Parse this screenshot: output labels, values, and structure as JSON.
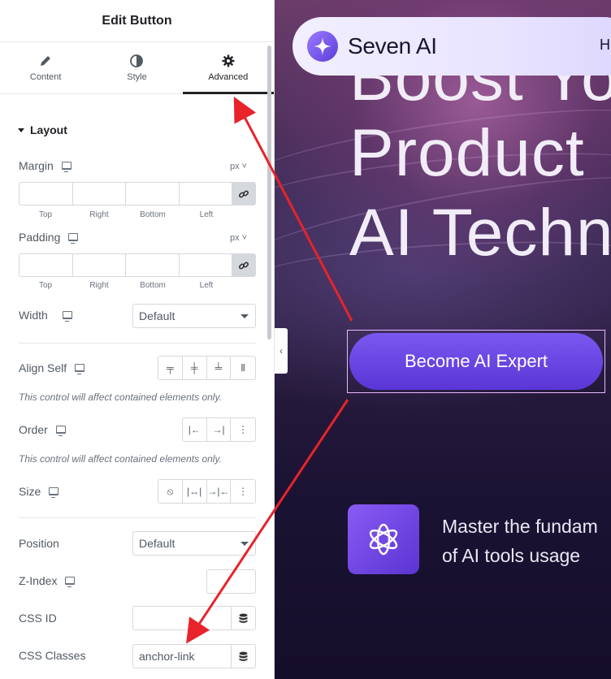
{
  "panel": {
    "title": "Edit Button",
    "tabs": [
      {
        "label": "Content",
        "icon": "pencil-icon"
      },
      {
        "label": "Style",
        "icon": "half-circle-icon"
      },
      {
        "label": "Advanced",
        "icon": "gear-icon",
        "active": true
      }
    ],
    "section": "Layout",
    "margin": {
      "label": "Margin",
      "unit": "px",
      "sides": [
        "Top",
        "Right",
        "Bottom",
        "Left"
      ]
    },
    "padding": {
      "label": "Padding",
      "unit": "px",
      "sides": [
        "Top",
        "Right",
        "Bottom",
        "Left"
      ]
    },
    "width": {
      "label": "Width",
      "value": "Default"
    },
    "align_self": {
      "label": "Align Self",
      "note": "This control will affect contained elements only."
    },
    "order": {
      "label": "Order",
      "note": "This control will affect contained elements only."
    },
    "size": {
      "label": "Size"
    },
    "position": {
      "label": "Position",
      "value": "Default"
    },
    "z_index": {
      "label": "Z-Index",
      "value": ""
    },
    "css_id": {
      "label": "CSS ID",
      "value": ""
    },
    "css_classes": {
      "label": "CSS Classes",
      "value": "anchor-link"
    }
  },
  "preview": {
    "brand": "Seven AI",
    "nav_link": "H",
    "hero_lines": [
      "Boost Yo",
      "Product",
      "AI Techn"
    ],
    "cta_label": "Become AI Expert",
    "feature_lines": [
      "Master the fundam",
      "of AI tools usage"
    ]
  },
  "colors": {
    "accent": "#5a36d6",
    "arrow": "#e8232a",
    "active_tab": "#1f2124"
  }
}
